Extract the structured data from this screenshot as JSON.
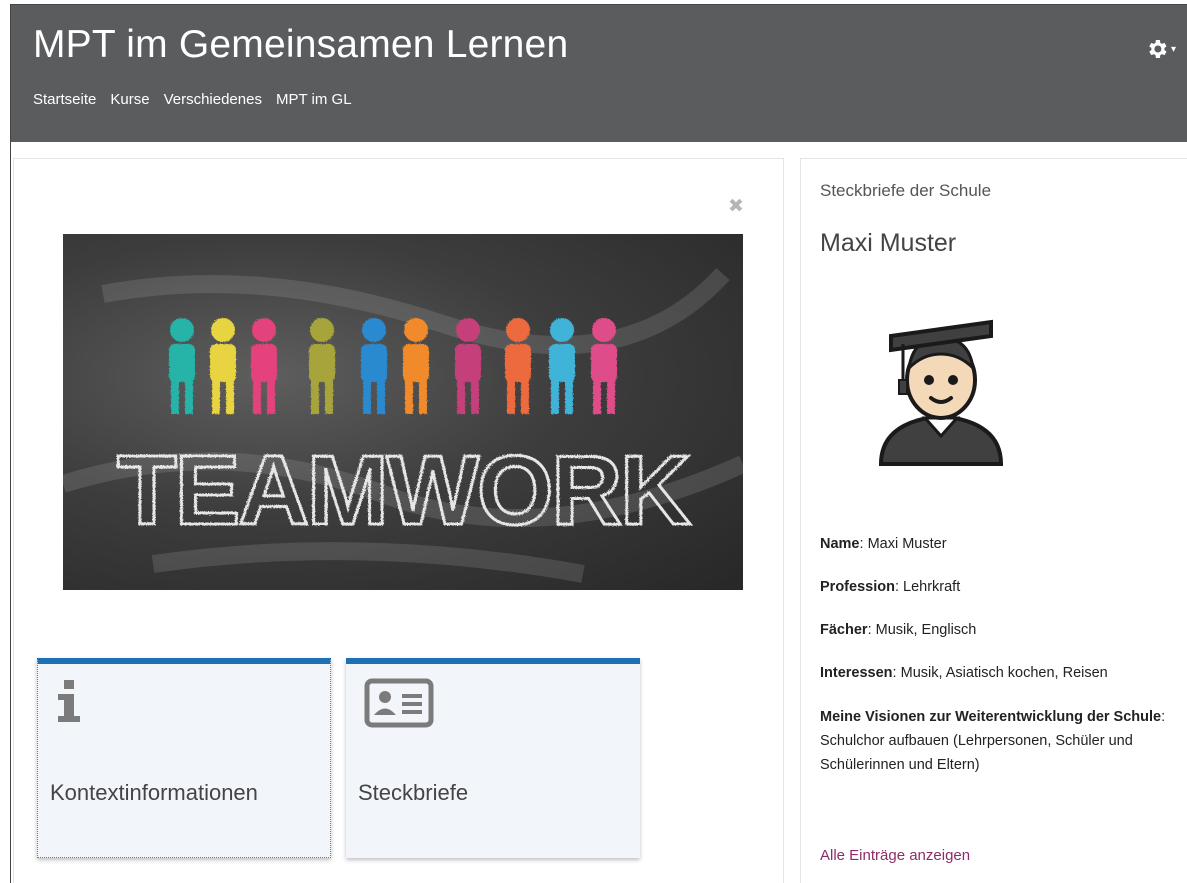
{
  "header": {
    "title": "MPT im Gemeinsamen Lernen",
    "breadcrumb": [
      "Startseite",
      "Kurse",
      "Verschiedenes",
      "MPT im GL"
    ],
    "settings_icon": "gear-icon",
    "settings_caret": "▾"
  },
  "main": {
    "close_label": "✖",
    "banner_image": "teamwork chalkboard illustration",
    "banner_text": "TEAMWORK",
    "tiles": [
      {
        "label": "Kontextinformationen",
        "icon": "info-icon"
      },
      {
        "label": "Steckbriefe",
        "icon": "id-card-icon"
      }
    ]
  },
  "sidebar": {
    "heading": "Steckbriefe der Schule",
    "name": "Maxi Muster",
    "avatar": "graduate-avatar-icon",
    "fields": [
      {
        "label": "Name",
        "value": "Maxi Muster"
      },
      {
        "label": "Profession",
        "value": "Lehrkraft"
      },
      {
        "label": "Fächer",
        "value": "Musik, Englisch"
      },
      {
        "label": "Interessen",
        "value": "Musik, Asiatisch kochen, Reisen"
      }
    ],
    "vision": {
      "label": "Meine Visionen zur Weiterentwicklung der Schule",
      "value": "Schulchor aufbauen (Lehrpersonen, Schüler und Schülerinnen und Eltern)"
    },
    "link": "Alle Einträge anzeigen"
  },
  "colors": {
    "header_bg": "#5b5c5e",
    "tile_accent": "#1f6fb5",
    "tile_bg": "#f2f6fa",
    "link": "#8f2b6a"
  }
}
